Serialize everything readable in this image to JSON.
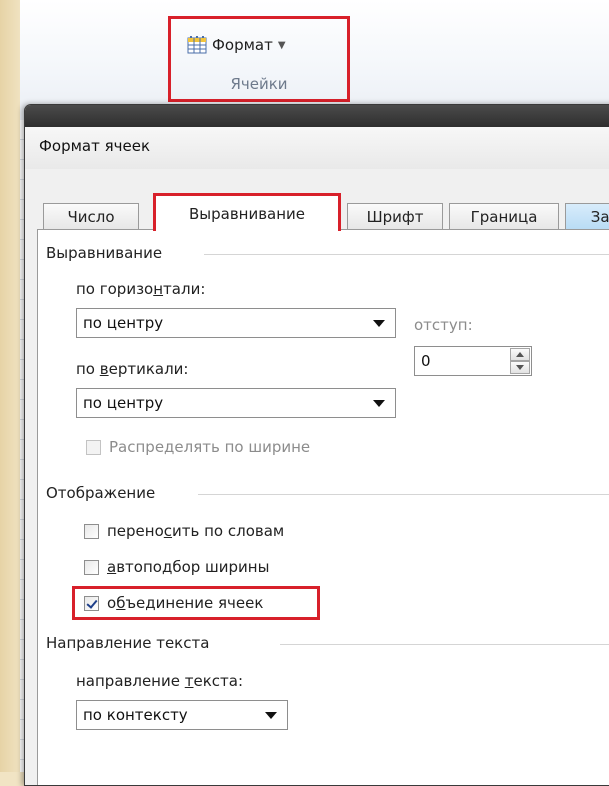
{
  "ribbon": {
    "format_button_label": "Формат",
    "group_label": "Ячейки",
    "accent_color": "#d8202a"
  },
  "dialog": {
    "title": "Формат ячеек",
    "tabs": [
      {
        "label": "Число"
      },
      {
        "label": "Выравнивание",
        "active": true
      },
      {
        "label": "Шрифт"
      },
      {
        "label": "Граница"
      },
      {
        "label": "Зал"
      }
    ],
    "alignment_section": "Выравнивание",
    "horizontal": {
      "label_pre": "по горизо",
      "label_mnemonic": "н",
      "label_post": "тали:",
      "value": "по центру"
    },
    "indent": {
      "label": "отступ:",
      "value": "0"
    },
    "vertical": {
      "label_pre": "по ",
      "label_mnemonic": "в",
      "label_post": "ертикали:",
      "value": "по центру"
    },
    "distribute_label": "Распределять по ширине",
    "display_section": "Отображение",
    "wrap": {
      "pre": "перено",
      "mnemonic": "с",
      "post": "ить по словам",
      "checked": false
    },
    "autofit": {
      "pre": "",
      "mnemonic": "а",
      "post": "втоподбор ширины",
      "checked": false
    },
    "merge": {
      "pre": "о",
      "mnemonic": "б",
      "post": "ъединение ячеек",
      "checked": true
    },
    "direction_section": "Направление текста",
    "direction": {
      "label_pre": "направление ",
      "label_mnemonic": "т",
      "label_post": "екста:",
      "value": "по контексту"
    }
  }
}
